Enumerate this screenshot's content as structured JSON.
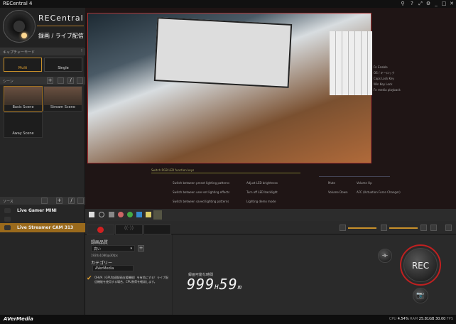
{
  "window": {
    "title": "RECentral 4",
    "controls": [
      "minimize",
      "maximize",
      "close"
    ]
  },
  "brand": {
    "name": "RECentral",
    "mode": "録画 / ライブ配信"
  },
  "capture_mode": {
    "header": "キャプチャーモード",
    "multi": "Multi",
    "single": "Single"
  },
  "scenes": {
    "header": "シーン",
    "items": [
      {
        "label": "Basic Scene",
        "selected": true
      },
      {
        "label": "Stream Scene"
      },
      {
        "label": "Away Scene"
      }
    ]
  },
  "sources": {
    "header": "ソース",
    "items": [
      {
        "label": "Live Gamer MINI"
      },
      {
        "label": ""
      },
      {
        "label": "Live Streamer CAM 313",
        "selected": true
      }
    ]
  },
  "preview": {
    "help_title": "Switch RGB LED function keys",
    "help_left": [
      "Switch between preset lighting patterns",
      "Switch between user-set lighting effects",
      "Switch between saved lighting patterns"
    ],
    "help_mid": [
      "Adjust LED brightness",
      "Turn off LED backlight",
      "Lighting demo mode"
    ],
    "help_right1": [
      "Mute",
      "Volume Down"
    ],
    "help_right2": [
      "Volume Up",
      "AFC (Actuation Force Changer)"
    ],
    "side_notes": [
      "Fn Enable",
      "OS / キーロック",
      "Caps Lock Key",
      "Win Key Lock",
      "Fn media playback"
    ]
  },
  "controls": {
    "tabs": [
      "record",
      "stream",
      "capture"
    ]
  },
  "settings": {
    "quality_label": "録画品質",
    "quality_value": "高い",
    "resolution": "1920x1080@30fps",
    "category_label": "カテゴリー",
    "category_value": "AVerMedia",
    "gpu_note": "OHVA（GPU加速録画支援機能）を有効にする！ライブ配信機能を使用する場合、CPU負荷を軽減します。"
  },
  "timer": {
    "label": "録画可能な時間",
    "hours": "999",
    "h": "H",
    "minutes": "59",
    "m": "m"
  },
  "rec": {
    "label": "REC"
  },
  "status": {
    "logo": "AVerMedia",
    "cpu_label": "CPU",
    "cpu": "4.54%",
    "ram_label": "RAM",
    "ram": "25.81GB",
    "fps": "30.00",
    "fps_label": "FPS"
  },
  "colors": {
    "accent": "#c8902a",
    "rec": "#d02020"
  }
}
